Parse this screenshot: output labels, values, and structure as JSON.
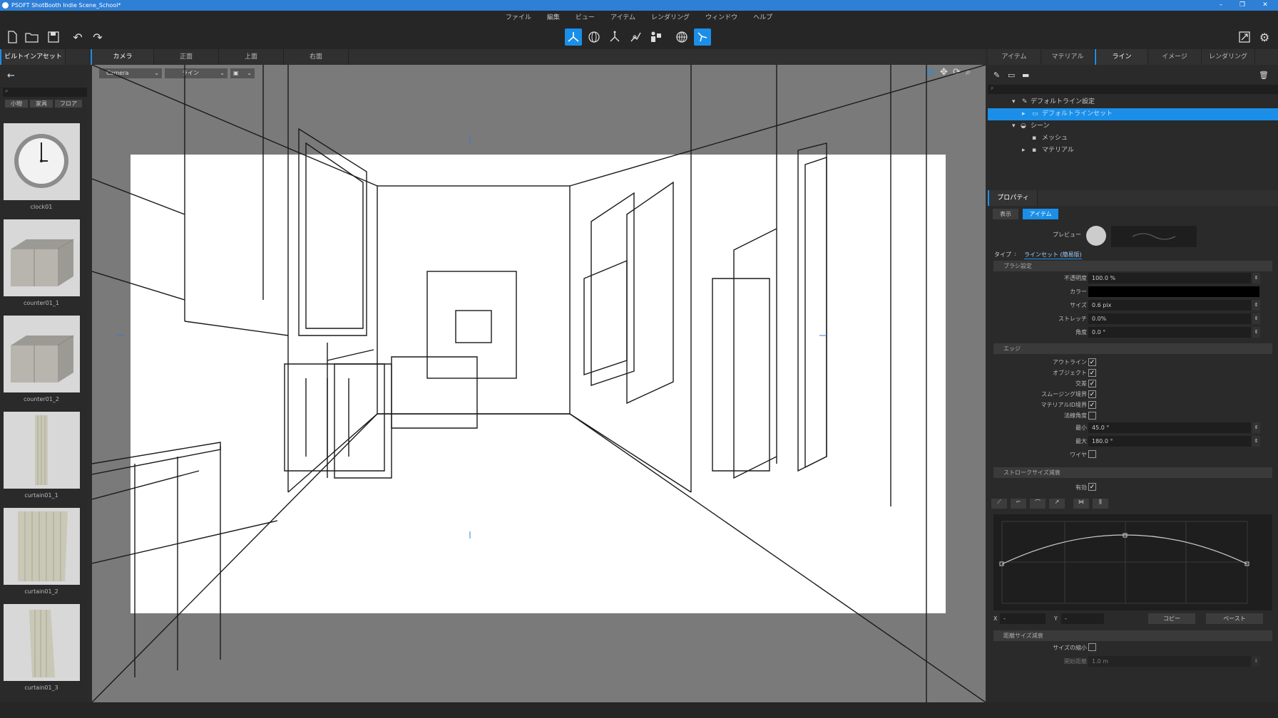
{
  "title": {
    "text": "PSOFT ShotBooth Indie  Scene_School*",
    "min": "–",
    "max": "❐",
    "close": "✕"
  },
  "menu": [
    "ファイル",
    "編集",
    "ビュー",
    "アイテム",
    "レンダリング",
    "ウィンドウ",
    "ヘルプ"
  ],
  "left_tabs": {
    "assets": "ビルトインアセット"
  },
  "view_tabs": [
    "カメラ",
    "正面",
    "上面",
    "右面"
  ],
  "search": {
    "placeholder": ""
  },
  "asset_filters": [
    "小物",
    "家具",
    "フロア"
  ],
  "assets": [
    {
      "name": "clock01"
    },
    {
      "name": "counter01_1"
    },
    {
      "name": "counter01_2"
    },
    {
      "name": "curtain01_1"
    },
    {
      "name": "curtain01_2"
    },
    {
      "name": "curtain01_3"
    }
  ],
  "viewport": {
    "camera_select": "Camera",
    "line_select": "ライン"
  },
  "right_tabs": [
    "アイテム",
    "マテリアル",
    "ライン",
    "イメージ",
    "レンダリング"
  ],
  "tree": [
    {
      "label": "デフォルトライン設定"
    },
    {
      "label": "デフォルトラインセット"
    },
    {
      "label": "シーン"
    },
    {
      "label": "メッシュ"
    },
    {
      "label": "マテリアル"
    }
  ],
  "properties": {
    "header": "プロパティ",
    "sub_tabs": [
      "表示",
      "アイテム"
    ],
    "preview_label": "プレビュー",
    "type_label": "タイプ",
    "type_sep": ":",
    "type_value": "ラインセット (簡易版)",
    "brush_section": "ブラシ設定",
    "brush": [
      {
        "label": "不透明度",
        "value": "100.0 %"
      },
      {
        "label": "カラー",
        "value": ""
      },
      {
        "label": "サイズ",
        "value": "0.6 pix"
      },
      {
        "label": "ストレッチ",
        "value": "0.0%"
      },
      {
        "label": "角度",
        "value": "0.0 °"
      }
    ],
    "edge_section": "エッジ",
    "edges": [
      {
        "label": "アウトライン",
        "checked": true
      },
      {
        "label": "オブジェクト",
        "checked": true
      },
      {
        "label": "交差",
        "checked": true
      },
      {
        "label": "スムージング境界",
        "checked": true
      },
      {
        "label": "マテリアルID境界",
        "checked": true
      },
      {
        "label": "法線角度",
        "checked": false
      }
    ],
    "angle_min": {
      "label": "最小",
      "value": "45.0 °"
    },
    "angle_max": {
      "label": "最大",
      "value": "180.0 °"
    },
    "wire": {
      "label": "ワイヤ",
      "checked": false
    },
    "stroke_section": "ストロークサイズ減衰",
    "stroke_enabled": {
      "label": "有効",
      "checked": true
    },
    "x_label": "X",
    "x_value": "-",
    "y_label": "Y",
    "y_value": "-",
    "copy": "コピー",
    "paste": "ペースト",
    "distance_section": "距離サイズ減衰",
    "size_shrink": {
      "label": "サイズの縮小",
      "checked": false
    },
    "start_distance": {
      "label": "開始距離",
      "value": "1.0 m"
    }
  },
  "colors": {
    "accent": "#1b8fe8",
    "panel": "#2a2a2a"
  }
}
